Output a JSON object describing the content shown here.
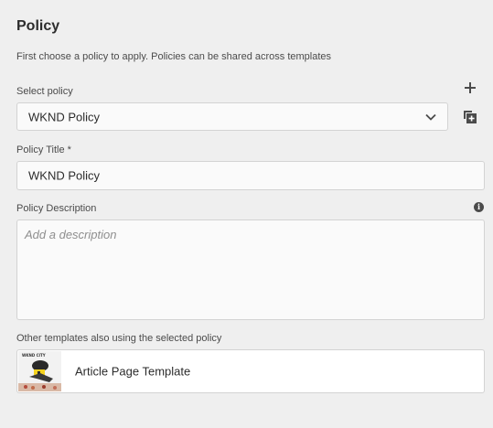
{
  "panel": {
    "heading": "Policy",
    "subtitle": "First choose a policy to apply. Policies can be shared across templates"
  },
  "select_policy": {
    "label": "Select policy",
    "value": "WKND Policy",
    "icon": "chevron-down-icon"
  },
  "actions": {
    "add_icon": "plus-icon",
    "duplicate_icon": "duplicate-icon"
  },
  "policy_title": {
    "label": "Policy Title *",
    "value": "WKND Policy"
  },
  "policy_description": {
    "label": "Policy Description",
    "placeholder": "Add a description",
    "value": "",
    "info_icon": "info-icon"
  },
  "templates": {
    "label": "Other templates also using the selected policy",
    "items": [
      {
        "name": "Article Page Template",
        "thumbnail_caption": "WKND CITY"
      }
    ]
  },
  "colors": {
    "background": "#efefef",
    "field_background": "#fafafa",
    "border": "#d3d3d3",
    "text": "#2c2c2c"
  }
}
